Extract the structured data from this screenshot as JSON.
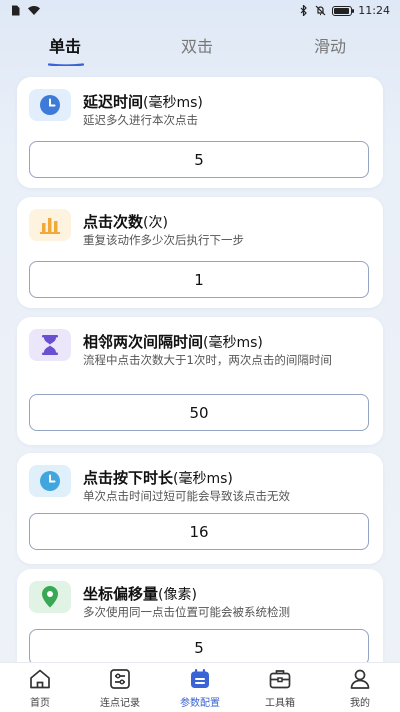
{
  "status_bar": {
    "time": "11:24"
  },
  "tabs": [
    {
      "label": "单击",
      "active": true
    },
    {
      "label": "双击",
      "active": false
    },
    {
      "label": "滑动",
      "active": false
    }
  ],
  "cards": [
    {
      "title": "延迟时间",
      "unit": "(毫秒ms)",
      "desc": "延迟多久进行本次点击",
      "value": "5",
      "icon": "clock-icon"
    },
    {
      "title": "点击次数",
      "unit": "(次)",
      "desc": "重复该动作多少次后执行下一步",
      "value": "1",
      "icon": "bar-chart-icon"
    },
    {
      "title": "相邻两次间隔时间",
      "unit": "(毫秒ms)",
      "desc": "流程中点击次数大于1次时，两次点击的间隔时间",
      "value": "50",
      "icon": "hourglass-icon"
    },
    {
      "title": "点击按下时长",
      "unit": "(毫秒ms)",
      "desc": "单次点击时间过短可能会导致该点击无效",
      "value": "16",
      "icon": "clock-icon"
    },
    {
      "title": "坐标偏移量",
      "unit": "(像素)",
      "desc": "多次使用同一点击位置可能会被系统检测",
      "value": "5",
      "icon": "location-pin-icon"
    }
  ],
  "bottom_nav": [
    {
      "label": "首页",
      "icon": "home-icon",
      "active": false
    },
    {
      "label": "连点记录",
      "icon": "sliders-icon",
      "active": false
    },
    {
      "label": "参数配置",
      "icon": "calendar-config-icon",
      "active": true
    },
    {
      "label": "工具箱",
      "icon": "toolbox-icon",
      "active": false
    },
    {
      "label": "我的",
      "icon": "user-icon",
      "active": false
    }
  ],
  "colors": {
    "accent": "#3a63d6",
    "field_border": "#93a3c1",
    "background": "#eef2f8"
  }
}
